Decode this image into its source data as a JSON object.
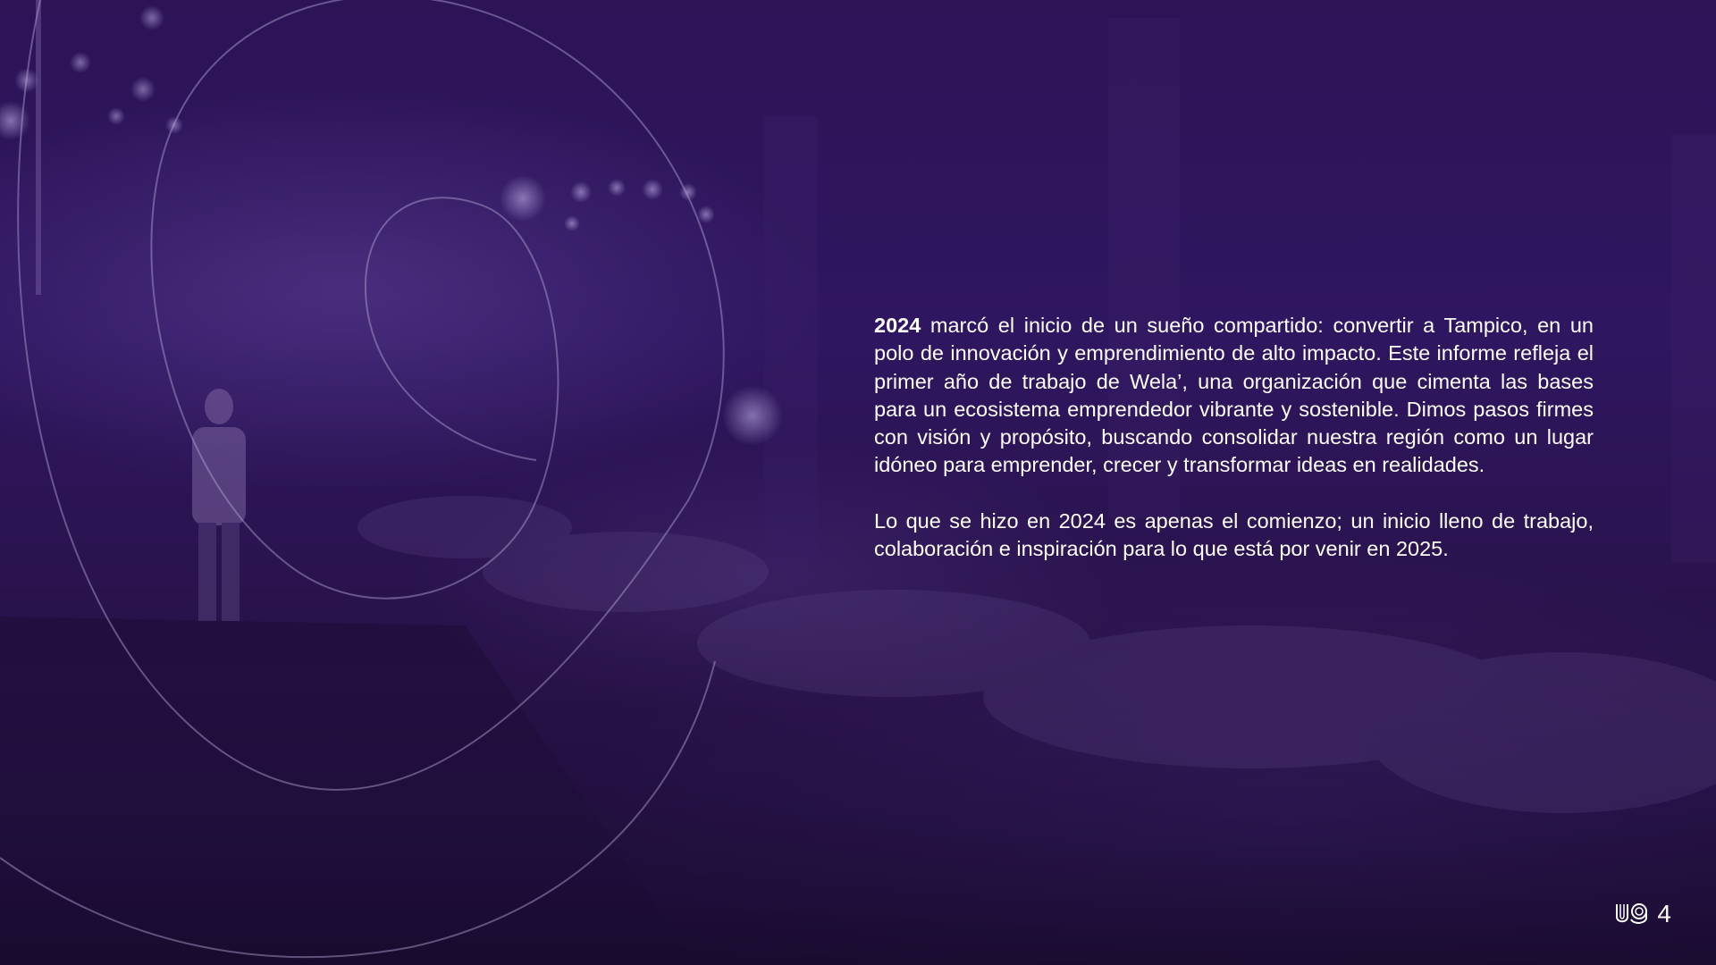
{
  "body": {
    "paragraph_1_lead": "2024",
    "paragraph_1_rest": " marcó el inicio de un sueño compartido: convertir a Tampico, en un polo de innovación y emprendimiento de alto impacto. Este informe refleja el primer año de trabajo de Wela’, una organización que cimenta las bases para un ecosistema emprendedor vibrante y sostenible. Dimos pasos firmes con visión y propósito, buscando consolidar nuestra región como un lugar idóneo para emprender, crecer y transformar ideas en realidades.",
    "paragraph_2": "Lo que se hizo en 2024 es apenas el comienzo; un inicio lleno de trabajo, colaboración e inspiración para lo que está por venir en 2025."
  },
  "footer": {
    "page_number": "4",
    "logo_icon": "wela-logo-icon"
  },
  "colors": {
    "overlay": "#2d1457",
    "text": "#ffffff",
    "outline": "#b9a7d9"
  }
}
